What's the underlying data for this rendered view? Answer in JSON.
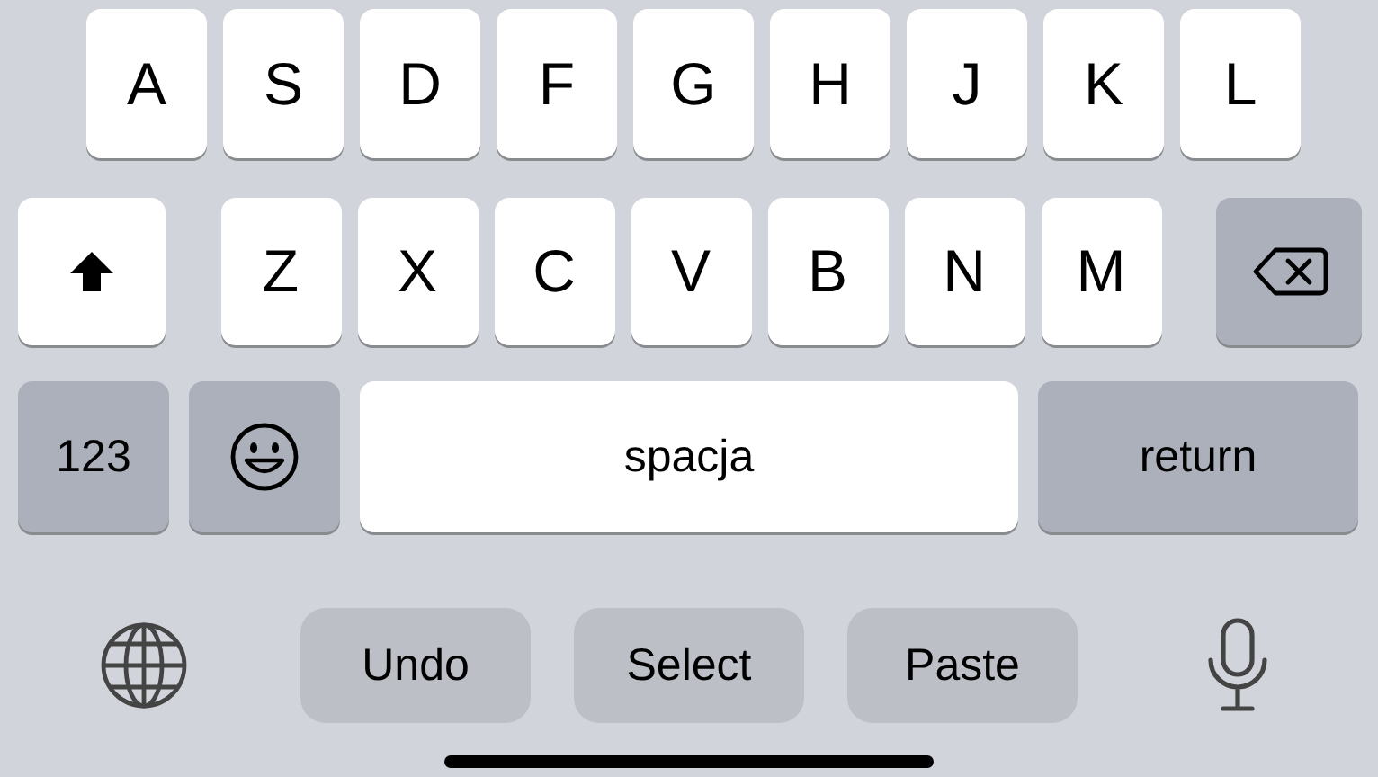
{
  "rows": [
    {
      "keys": [
        {
          "kind": "letter",
          "label": "A"
        },
        {
          "kind": "letter",
          "label": "S"
        },
        {
          "kind": "letter",
          "label": "D"
        },
        {
          "kind": "letter",
          "label": "F"
        },
        {
          "kind": "letter",
          "label": "G"
        },
        {
          "kind": "letter",
          "label": "H"
        },
        {
          "kind": "letter",
          "label": "J"
        },
        {
          "kind": "letter",
          "label": "K"
        },
        {
          "kind": "letter",
          "label": "L"
        }
      ]
    },
    {
      "keys": [
        {
          "kind": "shift",
          "on": true
        },
        {
          "kind": "letter",
          "label": "Z"
        },
        {
          "kind": "letter",
          "label": "X"
        },
        {
          "kind": "letter",
          "label": "C"
        },
        {
          "kind": "letter",
          "label": "V"
        },
        {
          "kind": "letter",
          "label": "B"
        },
        {
          "kind": "letter",
          "label": "N"
        },
        {
          "kind": "letter",
          "label": "M"
        },
        {
          "kind": "backspace"
        }
      ]
    },
    {
      "keys": [
        {
          "kind": "mode",
          "label": "123"
        },
        {
          "kind": "emoji"
        },
        {
          "kind": "space",
          "label": "spacja"
        },
        {
          "kind": "return",
          "label": "return"
        }
      ]
    }
  ],
  "toolbar": {
    "actions": [
      "Undo",
      "Select",
      "Paste"
    ]
  }
}
